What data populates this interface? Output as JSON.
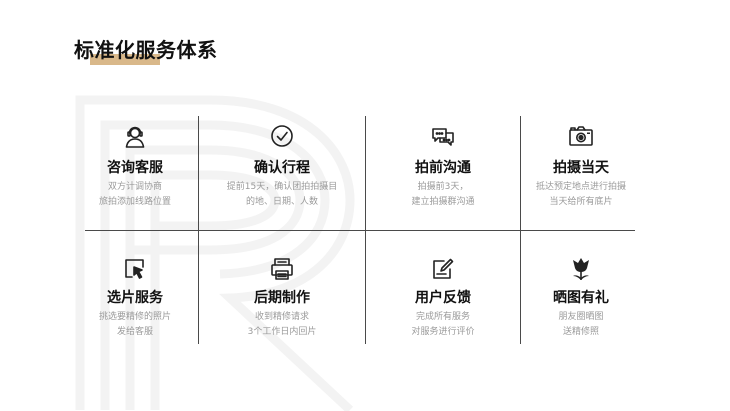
{
  "title": "标准化服务体系",
  "colors": {
    "accent": "#d9b88a",
    "line": "#4a4a4a",
    "muted": "#9a9a9a"
  },
  "services": [
    {
      "icon": "customer-service-icon",
      "title": "咨询客服",
      "desc": [
        "双方计调协商",
        "旅拍添加线路位置"
      ]
    },
    {
      "icon": "check-circle-icon",
      "title": "确认行程",
      "desc": [
        "提前15天，确认团拍拍摄目",
        "的地、日期、人数"
      ]
    },
    {
      "icon": "chat-bubbles-icon",
      "title": "拍前沟通",
      "desc": [
        "拍摄前3天，",
        "建立拍摄群沟通"
      ]
    },
    {
      "icon": "camera-icon",
      "title": "拍摄当天",
      "desc": [
        "抵达预定地点进行拍摄",
        "当天给所有底片"
      ]
    },
    {
      "icon": "photo-select-icon",
      "title": "选片服务",
      "desc": [
        "挑选要精修的照片",
        "发给客服"
      ]
    },
    {
      "icon": "printer-icon",
      "title": "后期制作",
      "desc": [
        "收到精修请求",
        "3个工作日内回片"
      ]
    },
    {
      "icon": "feedback-icon",
      "title": "用户反馈",
      "desc": [
        "完成所有服务",
        "对服务进行评价"
      ]
    },
    {
      "icon": "flower-icon",
      "title": "晒图有礼",
      "desc": [
        "朋友圈晒图",
        "送精修照"
      ]
    }
  ]
}
